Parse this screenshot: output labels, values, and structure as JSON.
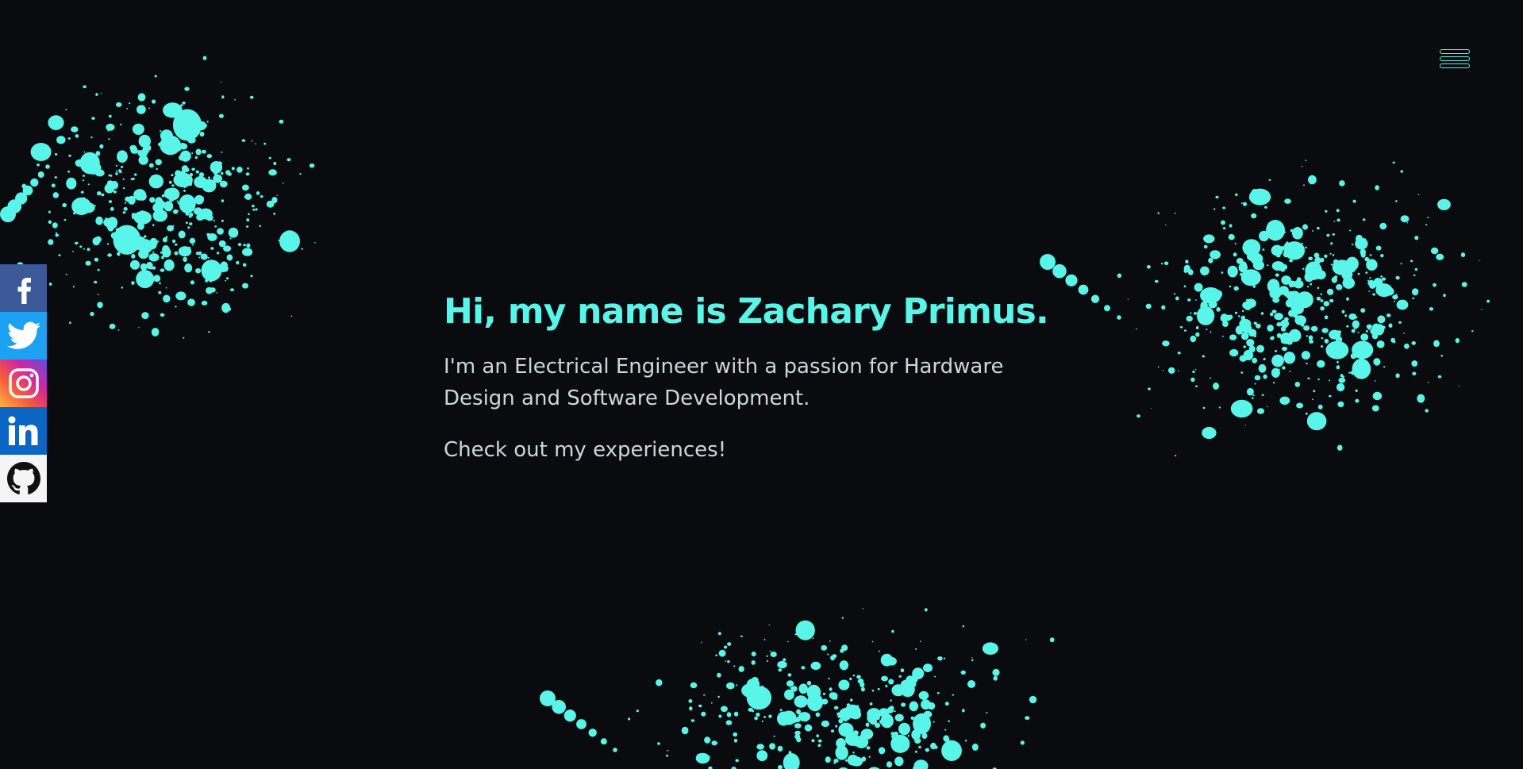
{
  "theme": {
    "background": "#0a0b0e",
    "accent": "#58f5e8",
    "text": "#cfd6dc"
  },
  "nav": {
    "menu_icon": "hamburger-menu-icon"
  },
  "social_links": [
    {
      "name": "facebook",
      "icon": "facebook-icon",
      "color": "#3b5998"
    },
    {
      "name": "twitter",
      "icon": "twitter-icon",
      "color": "#1da1f2"
    },
    {
      "name": "instagram",
      "icon": "instagram-icon",
      "color": "#d6249f"
    },
    {
      "name": "linkedin",
      "icon": "linkedin-icon",
      "color": "#0a66c2"
    },
    {
      "name": "github",
      "icon": "github-icon",
      "color": "#f5f5f5"
    }
  ],
  "hero": {
    "title": "Hi, my name is Zachary Primus.",
    "intro": "I'm an Electrical Engineer with a passion for Hardware Design and Software Development.",
    "cta": "Check out my experiences!"
  }
}
